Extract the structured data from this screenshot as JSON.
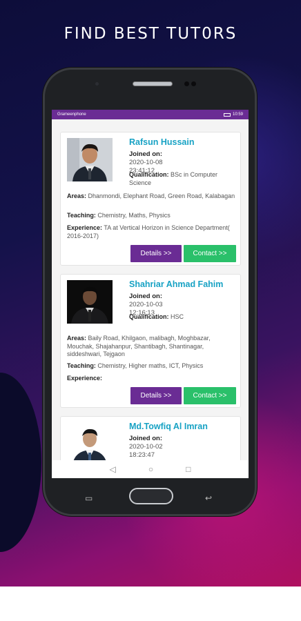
{
  "promo": {
    "headline": "FIND BEST TUT0RS"
  },
  "status_bar": {
    "carrier": "Grameenphone",
    "time": "10:59"
  },
  "tutors": [
    {
      "name": "Rafsun Hussain",
      "joined_label": "Joined on:",
      "joined": "2020-10-08 23:41:12",
      "qualification_label": "Qualification:",
      "qualification": "BSc in Computer Science",
      "areas_label": "Areas:",
      "areas": "Dhanmondi, Elephant Road, Green Road, Kalabagan",
      "teaching_label": "Teaching:",
      "teaching": "Chemistry, Maths, Physics",
      "experience_label": "Experience:",
      "experience": "TA at Vertical Horizon in Science Department( 2016-2017)",
      "details_label": "Details >>",
      "contact_label": "Contact >>"
    },
    {
      "name": "Shahriar Ahmad Fahim",
      "joined_label": "Joined on:",
      "joined": "2020-10-03 12:16:13",
      "qualification_label": "Qualification:",
      "qualification": "HSC",
      "areas_label": "Areas:",
      "areas": "Baily Road, Khilgaon, malibagh, Moghbazar, Mouchak, Shajahanpur, Shantibagh, Shantinagar, siddeshwari, Tejgaon",
      "teaching_label": "Teaching:",
      "teaching": "Chemistry, Higher maths, ICT, Physics",
      "experience_label": "Experience:",
      "experience": "",
      "details_label": "Details >>",
      "contact_label": "Contact >>"
    },
    {
      "name": "Md.Towfiq Al Imran",
      "joined_label": "Joined on:",
      "joined": "2020-10-02 18:23:47"
    }
  ],
  "nav": {
    "back_icon": "triangle-back-icon",
    "home_icon": "circle-home-icon",
    "recents_icon": "square-recents-icon"
  },
  "colors": {
    "accent_purple": "#6a2c94",
    "contact_green": "#2ac06a",
    "name_blue": "#17a2c4"
  }
}
